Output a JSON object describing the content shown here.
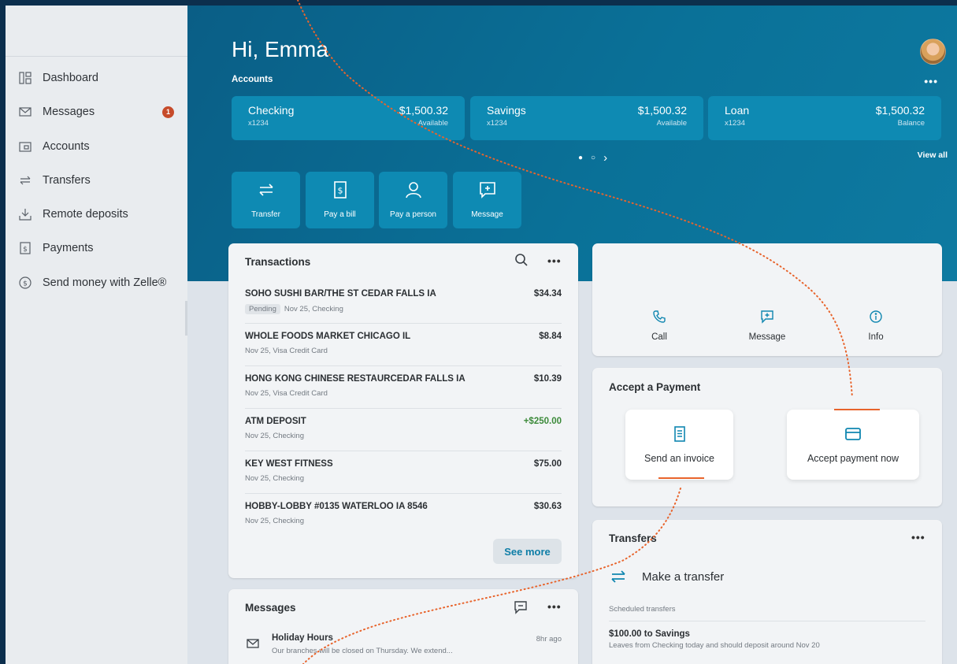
{
  "sidebar": {
    "items": [
      {
        "label": "Dashboard",
        "icon": "dashboard-icon"
      },
      {
        "label": "Messages",
        "icon": "envelope-icon",
        "badge": "1"
      },
      {
        "label": "Accounts",
        "icon": "wallet-icon"
      },
      {
        "label": "Transfers",
        "icon": "transfer-arrows-icon"
      },
      {
        "label": "Remote deposits",
        "icon": "download-tray-icon"
      },
      {
        "label": "Payments",
        "icon": "bill-icon"
      },
      {
        "label": "Send money with Zelle®",
        "icon": "dollar-circle-icon"
      }
    ]
  },
  "header": {
    "greeting": "Hi, Emma",
    "accounts_label": "Accounts",
    "more": "•••",
    "view_all": "View all"
  },
  "accounts": [
    {
      "name": "Checking",
      "number": "x1234",
      "amount": "$1,500.32",
      "sub": "Available"
    },
    {
      "name": "Savings",
      "number": "x1234",
      "amount": "$1,500.32",
      "sub": "Available"
    },
    {
      "name": "Loan",
      "number": "x1234",
      "amount": "$1,500.32",
      "sub": "Balance"
    }
  ],
  "pager": {
    "active": "●",
    "inactive": "○",
    "next": "›"
  },
  "quick_actions": [
    {
      "label": "Transfer",
      "icon": "transfer-icon"
    },
    {
      "label": "Pay a bill",
      "icon": "bill-icon"
    },
    {
      "label": "Pay a person",
      "icon": "person-icon"
    },
    {
      "label": "Message",
      "icon": "message-plus-icon"
    }
  ],
  "transactions": {
    "title": "Transactions",
    "more": "•••",
    "pending_label": "Pending",
    "items": [
      {
        "desc": "SOHO SUSHI BAR/THE ST CEDAR FALLS IA",
        "meta": "Nov 25, Checking",
        "amount": "$34.34",
        "pending": true
      },
      {
        "desc": "WHOLE FOODS MARKET CHICAGO IL",
        "meta": "Nov 25, Visa Credit Card",
        "amount": "$8.84"
      },
      {
        "desc": "HONG KONG CHINESE RESTAURCEDAR FALLS IA",
        "meta": "Nov 25, Visa Credit Card",
        "amount": "$10.39"
      },
      {
        "desc": "ATM DEPOSIT",
        "meta": "Nov 25, Checking",
        "amount": "+$250.00",
        "positive": true
      },
      {
        "desc": "KEY WEST FITNESS",
        "meta": "Nov 25, Checking",
        "amount": "$75.00"
      },
      {
        "desc": "HOBBY-LOBBY #0135 WATERLOO IA 8546",
        "meta": "Nov 25, Checking",
        "amount": "$30.63"
      }
    ],
    "see_more": "See more"
  },
  "contact": {
    "call": "Call",
    "message": "Message",
    "info": "Info"
  },
  "accept_payment": {
    "title": "Accept a Payment",
    "send_invoice": "Send an invoice",
    "accept_now": "Accept payment now"
  },
  "transfers": {
    "title": "Transfers",
    "more": "•••",
    "make": "Make a transfer",
    "scheduled_label": "Scheduled transfers",
    "item_title": "$100.00 to Savings",
    "item_sub": "Leaves from Checking today and should deposit around Nov 20"
  },
  "messages": {
    "title": "Messages",
    "more": "•••",
    "item_title": "Holiday Hours",
    "item_preview": "Our branches will be closed on Thursday. We extend...",
    "item_time": "8hr ago"
  },
  "colors": {
    "accent": "#0f86b0",
    "highlight": "#e8642c",
    "badge": "#c64b2a",
    "positive": "#3c8a3a"
  }
}
